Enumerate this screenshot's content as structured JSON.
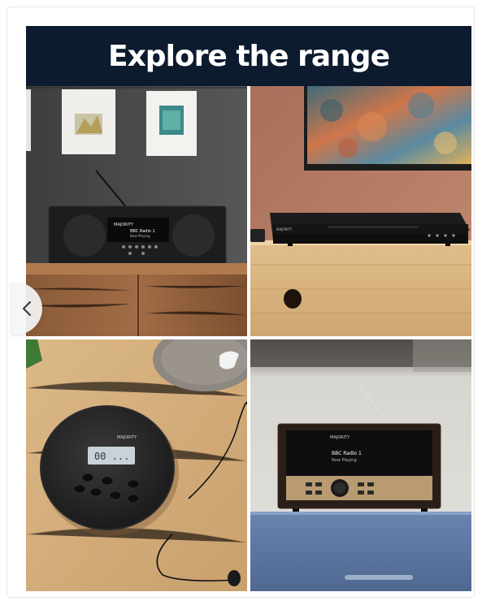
{
  "banner": {
    "title": "Explore the range",
    "background": "#0c1b2e"
  },
  "products": [
    {
      "name": "dab-stereo-radio",
      "screen_lines": [
        "MAJORITY",
        "BBC Radio 1",
        "Now Playing"
      ]
    },
    {
      "name": "dvd-player",
      "brand": "MAJORITY"
    },
    {
      "name": "portable-cd-player",
      "brand": "MAJORITY",
      "display": "00 ..."
    },
    {
      "name": "wooden-dab-radio",
      "brand": "MAJORITY",
      "screen_lines": [
        "BBC Radio 1",
        "Now Playing"
      ]
    }
  ],
  "navigation": {
    "prev_icon": "chevron-left-icon"
  }
}
